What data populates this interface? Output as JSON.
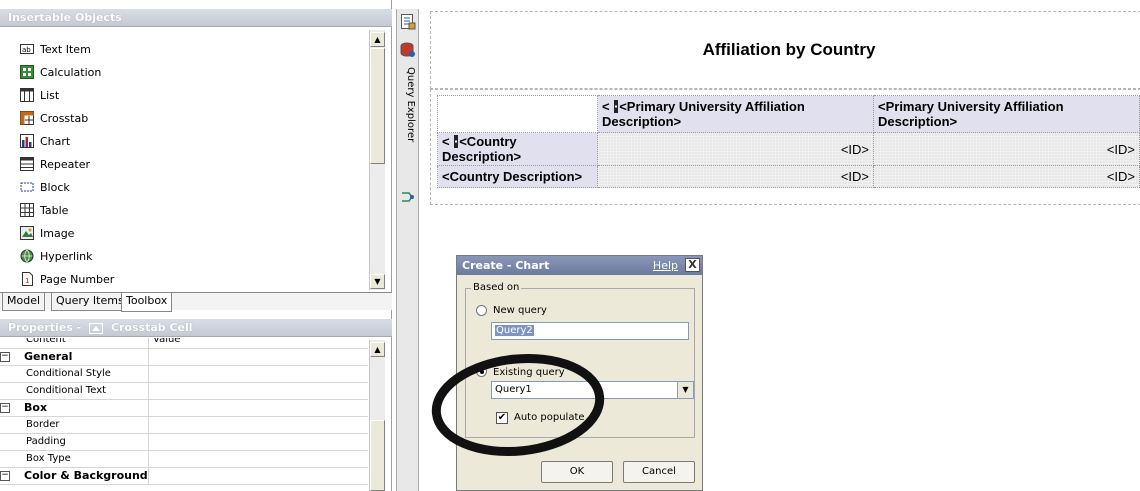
{
  "left_pane": {
    "insertable_title": "Insertable Objects",
    "toolbox_items": [
      {
        "label": "Text Item",
        "icon": "text-item-icon"
      },
      {
        "label": "Calculation",
        "icon": "calculation-icon"
      },
      {
        "label": "List",
        "icon": "list-icon"
      },
      {
        "label": "Crosstab",
        "icon": "crosstab-icon"
      },
      {
        "label": "Chart",
        "icon": "chart-icon"
      },
      {
        "label": "Repeater",
        "icon": "repeater-icon"
      },
      {
        "label": "Block",
        "icon": "block-icon"
      },
      {
        "label": "Table",
        "icon": "table-icon"
      },
      {
        "label": "Image",
        "icon": "image-icon"
      },
      {
        "label": "Hyperlink",
        "icon": "hyperlink-icon"
      },
      {
        "label": "Page Number",
        "icon": "page-number-icon"
      }
    ],
    "tabs": [
      "Model",
      "Query Items",
      "Toolbox"
    ],
    "active_tab": "Toolbox",
    "properties_title": "Properties -",
    "properties_context": "Crosstab Cell",
    "properties": [
      {
        "name": "Content",
        "value": "Value",
        "group": false
      },
      {
        "name": "General",
        "value": "",
        "group": true
      },
      {
        "name": "Conditional Style",
        "value": "",
        "group": false
      },
      {
        "name": "Conditional Text",
        "value": "",
        "group": false
      },
      {
        "name": "Box",
        "value": "",
        "group": true
      },
      {
        "name": "Border",
        "value": "",
        "group": false
      },
      {
        "name": "Padding",
        "value": "",
        "group": false
      },
      {
        "name": "Box Type",
        "value": "",
        "group": false
      },
      {
        "name": "Color & Background",
        "value": "",
        "group": true
      }
    ]
  },
  "vertical_strip": {
    "query_explorer_label": "Query Explorer"
  },
  "report": {
    "title": "Affiliation by Country",
    "column_header": "<Primary University Affiliation Description>",
    "row_header": "<Country Description>",
    "cell_value": "<ID>"
  },
  "dialog": {
    "title": "Create - Chart",
    "help": "Help",
    "close": "X",
    "group_label": "Based on",
    "new_query_label": "New query",
    "new_query_value": "Query2",
    "existing_query_label": "Existing query",
    "existing_query_value": "Query1",
    "auto_populate_label": "Auto populate",
    "auto_populate_checked": true,
    "selected_option": "existing_query",
    "ok_label": "OK",
    "cancel_label": "Cancel"
  },
  "colors": {
    "pane_title_bg": "#c4c9d4",
    "dialog_title_bg": "#6b7a9e",
    "crosstab_header_bg": "#e0e0ef",
    "annotation_circle": "#111111"
  }
}
